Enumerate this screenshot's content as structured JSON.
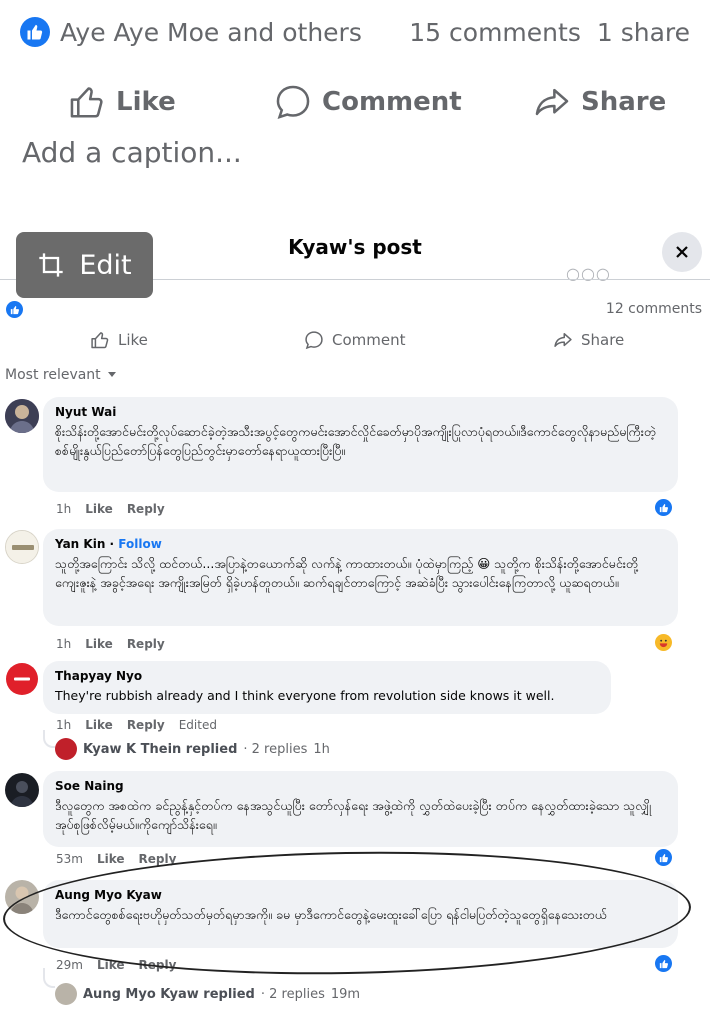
{
  "outer": {
    "reaction_names": "Aye Aye Moe and others",
    "comments_count": "15 comments",
    "shares_count": "1 share",
    "actions": {
      "like": "Like",
      "comment": "Comment",
      "share": "Share"
    },
    "caption_placeholder": "Add a caption...",
    "edit_label": "Edit"
  },
  "post": {
    "title": "Kyaw's post",
    "comment_count": "12 comments",
    "actions": {
      "like": "Like",
      "comment": "Comment",
      "share": "Share"
    },
    "sort_label": "Most relevant"
  },
  "comments": [
    {
      "author": "Nyut Wai",
      "text": "စိုးသိန်းတို့အောင်မင်းတို့လုပ်ဆောင်ခဲ့တဲ့အသီးအပွင့်တွေကမင်းအောင်လှိုင်ခေတ်မှာပိုအကျိုးပြုလာပုံရတယ်။ဒီကောင်တွေလိုနာမည်မကြီးတဲ့စစ်မျိုးနွယ်ပြည်တော်ပြန်တွေပြည်တွင်းမှာတော်နေရာယူထားပြီးပြီ။",
      "time": "1h",
      "like": "Like",
      "reply": "Reply"
    },
    {
      "author": "Yan Kin",
      "follow": "Follow",
      "text": "သူတို့အကြောင်း သိလို့ ထင်တယ်...အပြာနဲ့တယောက်ဆို လက်နဲ့ ကာထားတယ်။ ပုံထဲမှာကြည့် 😀 သူတို့က စိုးသိန်းတို့အောင်မင်းတို့ကျေးဇူးနဲ့ အခွင့်အရေး အကျိုးအမြတ် ရှိခဲ့ဟန်တူတယ်။ ဆက်ရချင်တာကြောင့် အဆဲခံပြီး သွားပေါင်းနေကြတာလို့ ယူဆရတယ်။",
      "time": "1h",
      "like": "Like",
      "reply": "Reply"
    },
    {
      "author": "Thapyay Nyo",
      "text": "They're rubbish already and I think everyone from revolution side knows it well.",
      "time": "1h",
      "like": "Like",
      "reply": "Reply",
      "edited": "Edited",
      "replies_author": "Kyaw K Thein replied",
      "replies_count": "· 2 replies",
      "replies_time": "1h"
    },
    {
      "author": "Soe Naing",
      "text": "ဒီလူတွေက အစထဲက ခင်ညွန့်နှင့်တပ်က နေအသွင်ယူပြီး တော်လှန်ရေး အဖွဲ့ထဲကို လွှတ်ထဲပေးခဲ့ပြီး တပ်က နေလွှတ်ထားခဲ့သော သူလျှိုအုပ်စုဖြစ်လိမ့်မယ်။ကိုကျော်သိန်းရေ။",
      "time": "53m",
      "like": "Like",
      "reply": "Reply"
    },
    {
      "author": "Aung Myo Kyaw",
      "text": "ဒီကောင်တွေစစ်ရေးဗဟိုမှတ်သတ်မှတ်ရမှာအကို။ ခမ မှာဒီကောင်တွေနဲ့မေးထူးခေါ်ပြော ရန်ငါမပြတ်တဲ့သူတွေရှိနေသေးတယ်",
      "time": "29m",
      "like": "Like",
      "reply": "Reply",
      "replies_author": "Aung Myo Kyaw replied",
      "replies_count": "· 2 replies",
      "replies_time": "19m"
    }
  ]
}
